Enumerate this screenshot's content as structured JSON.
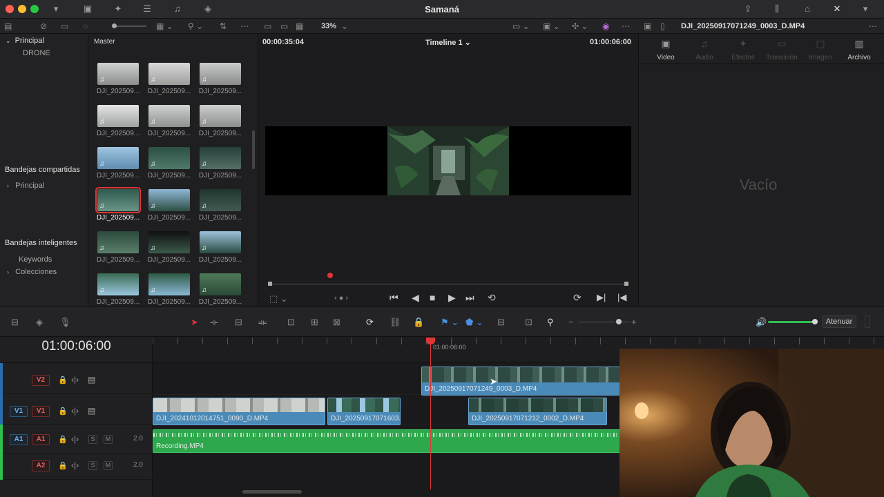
{
  "app": {
    "title": "Samaná"
  },
  "toolbar": {
    "zoom": "33%",
    "clip_name": "DJI_20250917071249_0003_D.MP4"
  },
  "left_panel": {
    "section_principal": "Principal",
    "drone": "DRONE",
    "shared_bins": "Bandejas compartidas",
    "shared_principal": "Principal",
    "smart_bins": "Bandejas inteligentes",
    "keywords": "Keywords",
    "collections": "Colecciones"
  },
  "media_pool": {
    "title": "Master",
    "thumbs": [
      "DJI_202509...",
      "DJI_202509...",
      "DJI_202509...",
      "DJI_202509...",
      "DJI_202509...",
      "DJI_202509...",
      "DJI_202509...",
      "DJI_202509...",
      "DJI_202509...",
      "DJI_202509...",
      "DJI_202509...",
      "DJI_202509...",
      "DJI_202509...",
      "DJI_202509...",
      "DJI_202509...",
      "DJI_202509...",
      "DJI_202509...",
      "DJI_202509..."
    ],
    "selected_index": 9
  },
  "viewer": {
    "timecode_left": "00:00:35:04",
    "timeline_name": "Timeline 1",
    "timecode_right": "01:00:06:00"
  },
  "inspector": {
    "tabs": [
      "Video",
      "Audio",
      "Efectos",
      "Transición",
      "Imagen",
      "Archivo"
    ],
    "empty": "Vacío"
  },
  "timeline_toolbar": {
    "attenuate": "Atenuar"
  },
  "timeline": {
    "timecode": "01:00:06:00",
    "playhead_tc": "01:00:06:00",
    "tracks": [
      {
        "id": "V2",
        "patch": ""
      },
      {
        "id": "V1",
        "patch": "V1"
      },
      {
        "id": "A1",
        "patch": "A1",
        "level": "2.0"
      },
      {
        "id": "A2",
        "patch": "",
        "level": "2.0"
      }
    ],
    "clips": {
      "v2_clip": "DJI_20250917071249_0003_D.MP4",
      "v1_clip1": "DJI_20241012014751_0090_D.MP4",
      "v1_clip2": "DJI_20250917071603...",
      "v1_clip3": "DJI_20250917071212_0002_D.MP4",
      "a1_clip": "Recording.MP4"
    },
    "solo_label": "S",
    "mute_label": "M"
  }
}
